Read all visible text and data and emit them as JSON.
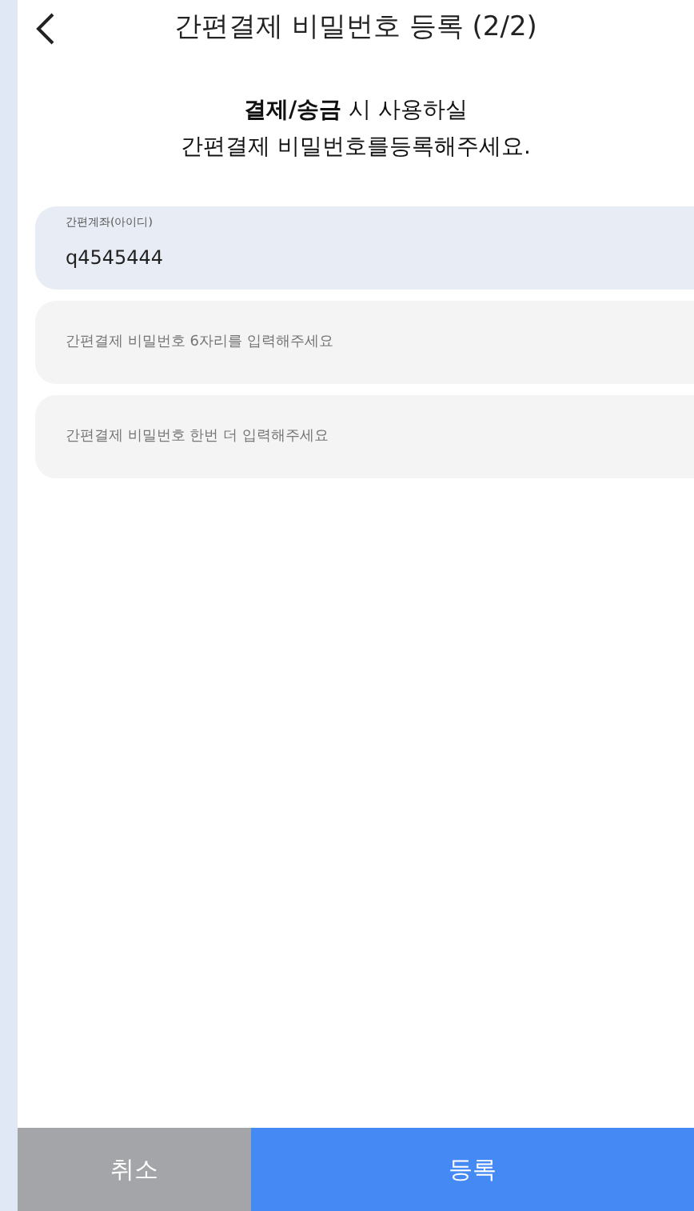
{
  "header": {
    "title": "간편결제 비밀번호 등록 (2/2)"
  },
  "intro": [
    "**결제/송금** 시 사용하실",
    "간편결제 비밀번호를등록해주세요."
  ],
  "fields": [
    {
      "kind": "readonly",
      "label": "간편계좌(아이디)",
      "value": "q4545444"
    },
    {
      "kind": "input",
      "placeholder": "간편결제 비밀번호 6자리를 입력해주세요"
    },
    {
      "kind": "input",
      "placeholder": "간편결제 비밀번호 한번 더 입력해주세요"
    }
  ],
  "buttons": [
    {
      "kind": "cancel",
      "label": "취소"
    },
    {
      "kind": "primary",
      "label": "등록"
    }
  ]
}
